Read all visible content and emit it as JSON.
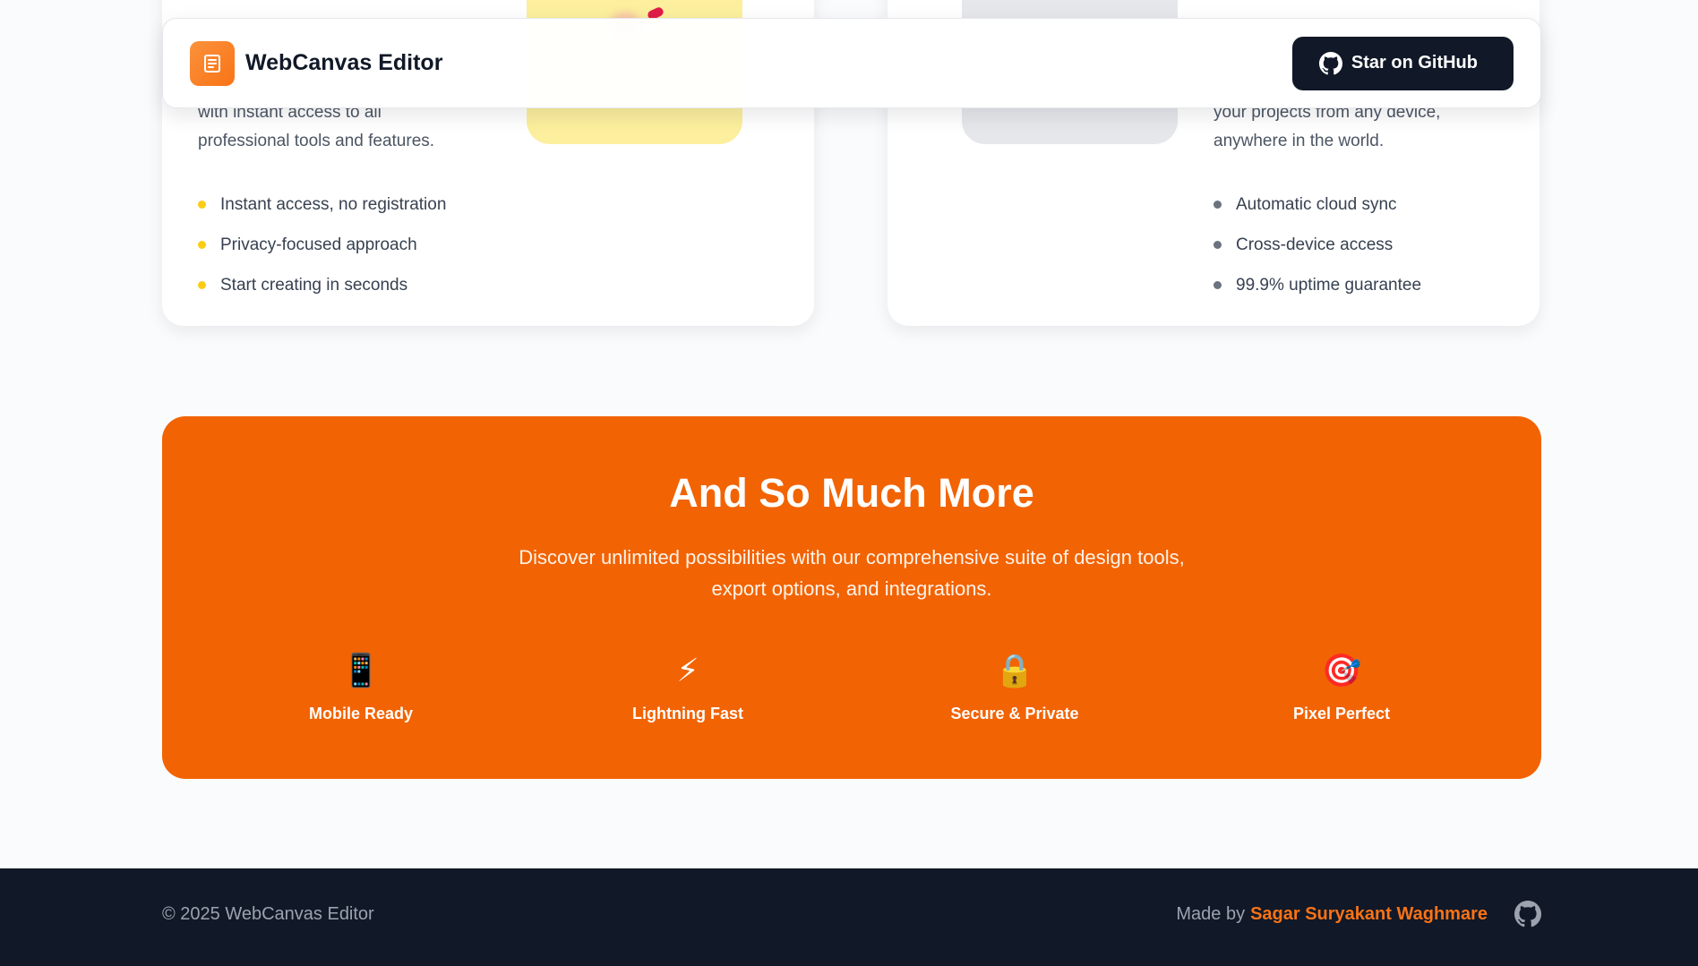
{
  "header": {
    "brand_name": "WebCanvas Editor",
    "github_button_label": "Star on GitHub"
  },
  "cards": {
    "left": {
      "description": "with instant access to all\nprofessional tools and features.",
      "features": [
        "Instant access, no registration",
        "Privacy-focused approach",
        "Start creating in seconds"
      ],
      "accent": "#facc15"
    },
    "right": {
      "description": "your projects from any device,\nanywhere in the world.",
      "features": [
        "Automatic cloud sync",
        "Cross-device access",
        "99.9% uptime guarantee"
      ],
      "accent": "#6b7280"
    }
  },
  "promo": {
    "title": "And So Much More",
    "description": "Discover unlimited possibilities with our comprehensive suite of design tools, export options, and integrations.",
    "features": [
      {
        "icon": "mobile-phone-icon",
        "emoji": "📱",
        "label": "Mobile Ready"
      },
      {
        "icon": "lightning-icon",
        "emoji": "⚡",
        "label": "Lightning Fast"
      },
      {
        "icon": "lock-icon",
        "emoji": "🔒",
        "label": "Secure & Private"
      },
      {
        "icon": "target-icon",
        "emoji": "🎯",
        "label": "Pixel Perfect"
      }
    ],
    "background": "#f26303"
  },
  "footer": {
    "copyright": "© 2025 WebCanvas Editor",
    "made_by": "Made by",
    "author": "Sagar Suryakant Waghmare"
  },
  "colors": {
    "brand_orange": "#f97316",
    "dark": "#111827"
  }
}
